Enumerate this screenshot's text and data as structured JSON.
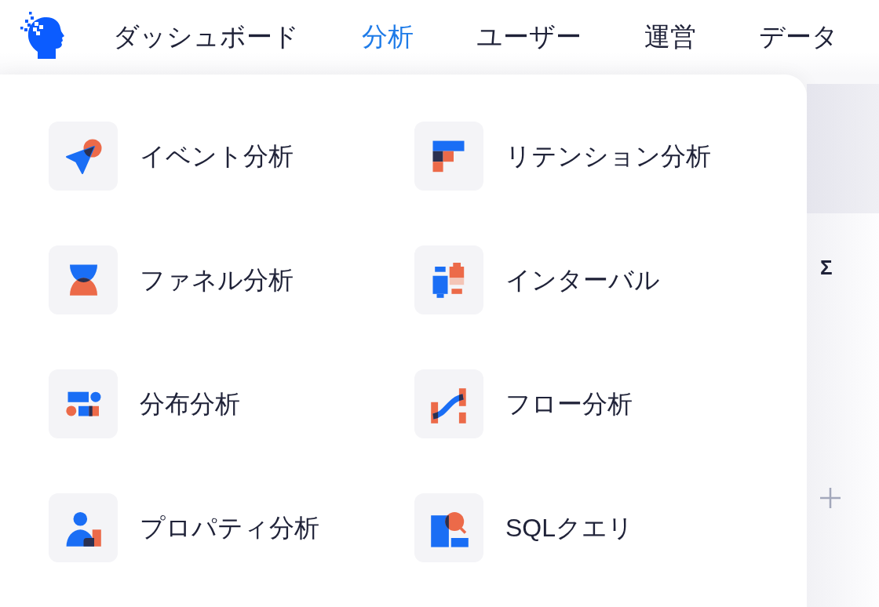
{
  "nav": {
    "tabs": [
      {
        "label": "ダッシュボード",
        "selected": false
      },
      {
        "label": "分析",
        "selected": true
      },
      {
        "label": "ユーザー",
        "selected": false
      },
      {
        "label": "運営",
        "selected": false
      },
      {
        "label": "データ",
        "selected": false
      }
    ]
  },
  "menu": {
    "items": [
      {
        "label": "イベント分析"
      },
      {
        "label": "リテンション分析"
      },
      {
        "label": "ファネル分析"
      },
      {
        "label": "インターバル"
      },
      {
        "label": "分布分析"
      },
      {
        "label": "フロー分析"
      },
      {
        "label": "プロパティ分析"
      },
      {
        "label": "SQLクエリ"
      }
    ]
  },
  "side_panel": {
    "symbol": "Σ"
  }
}
